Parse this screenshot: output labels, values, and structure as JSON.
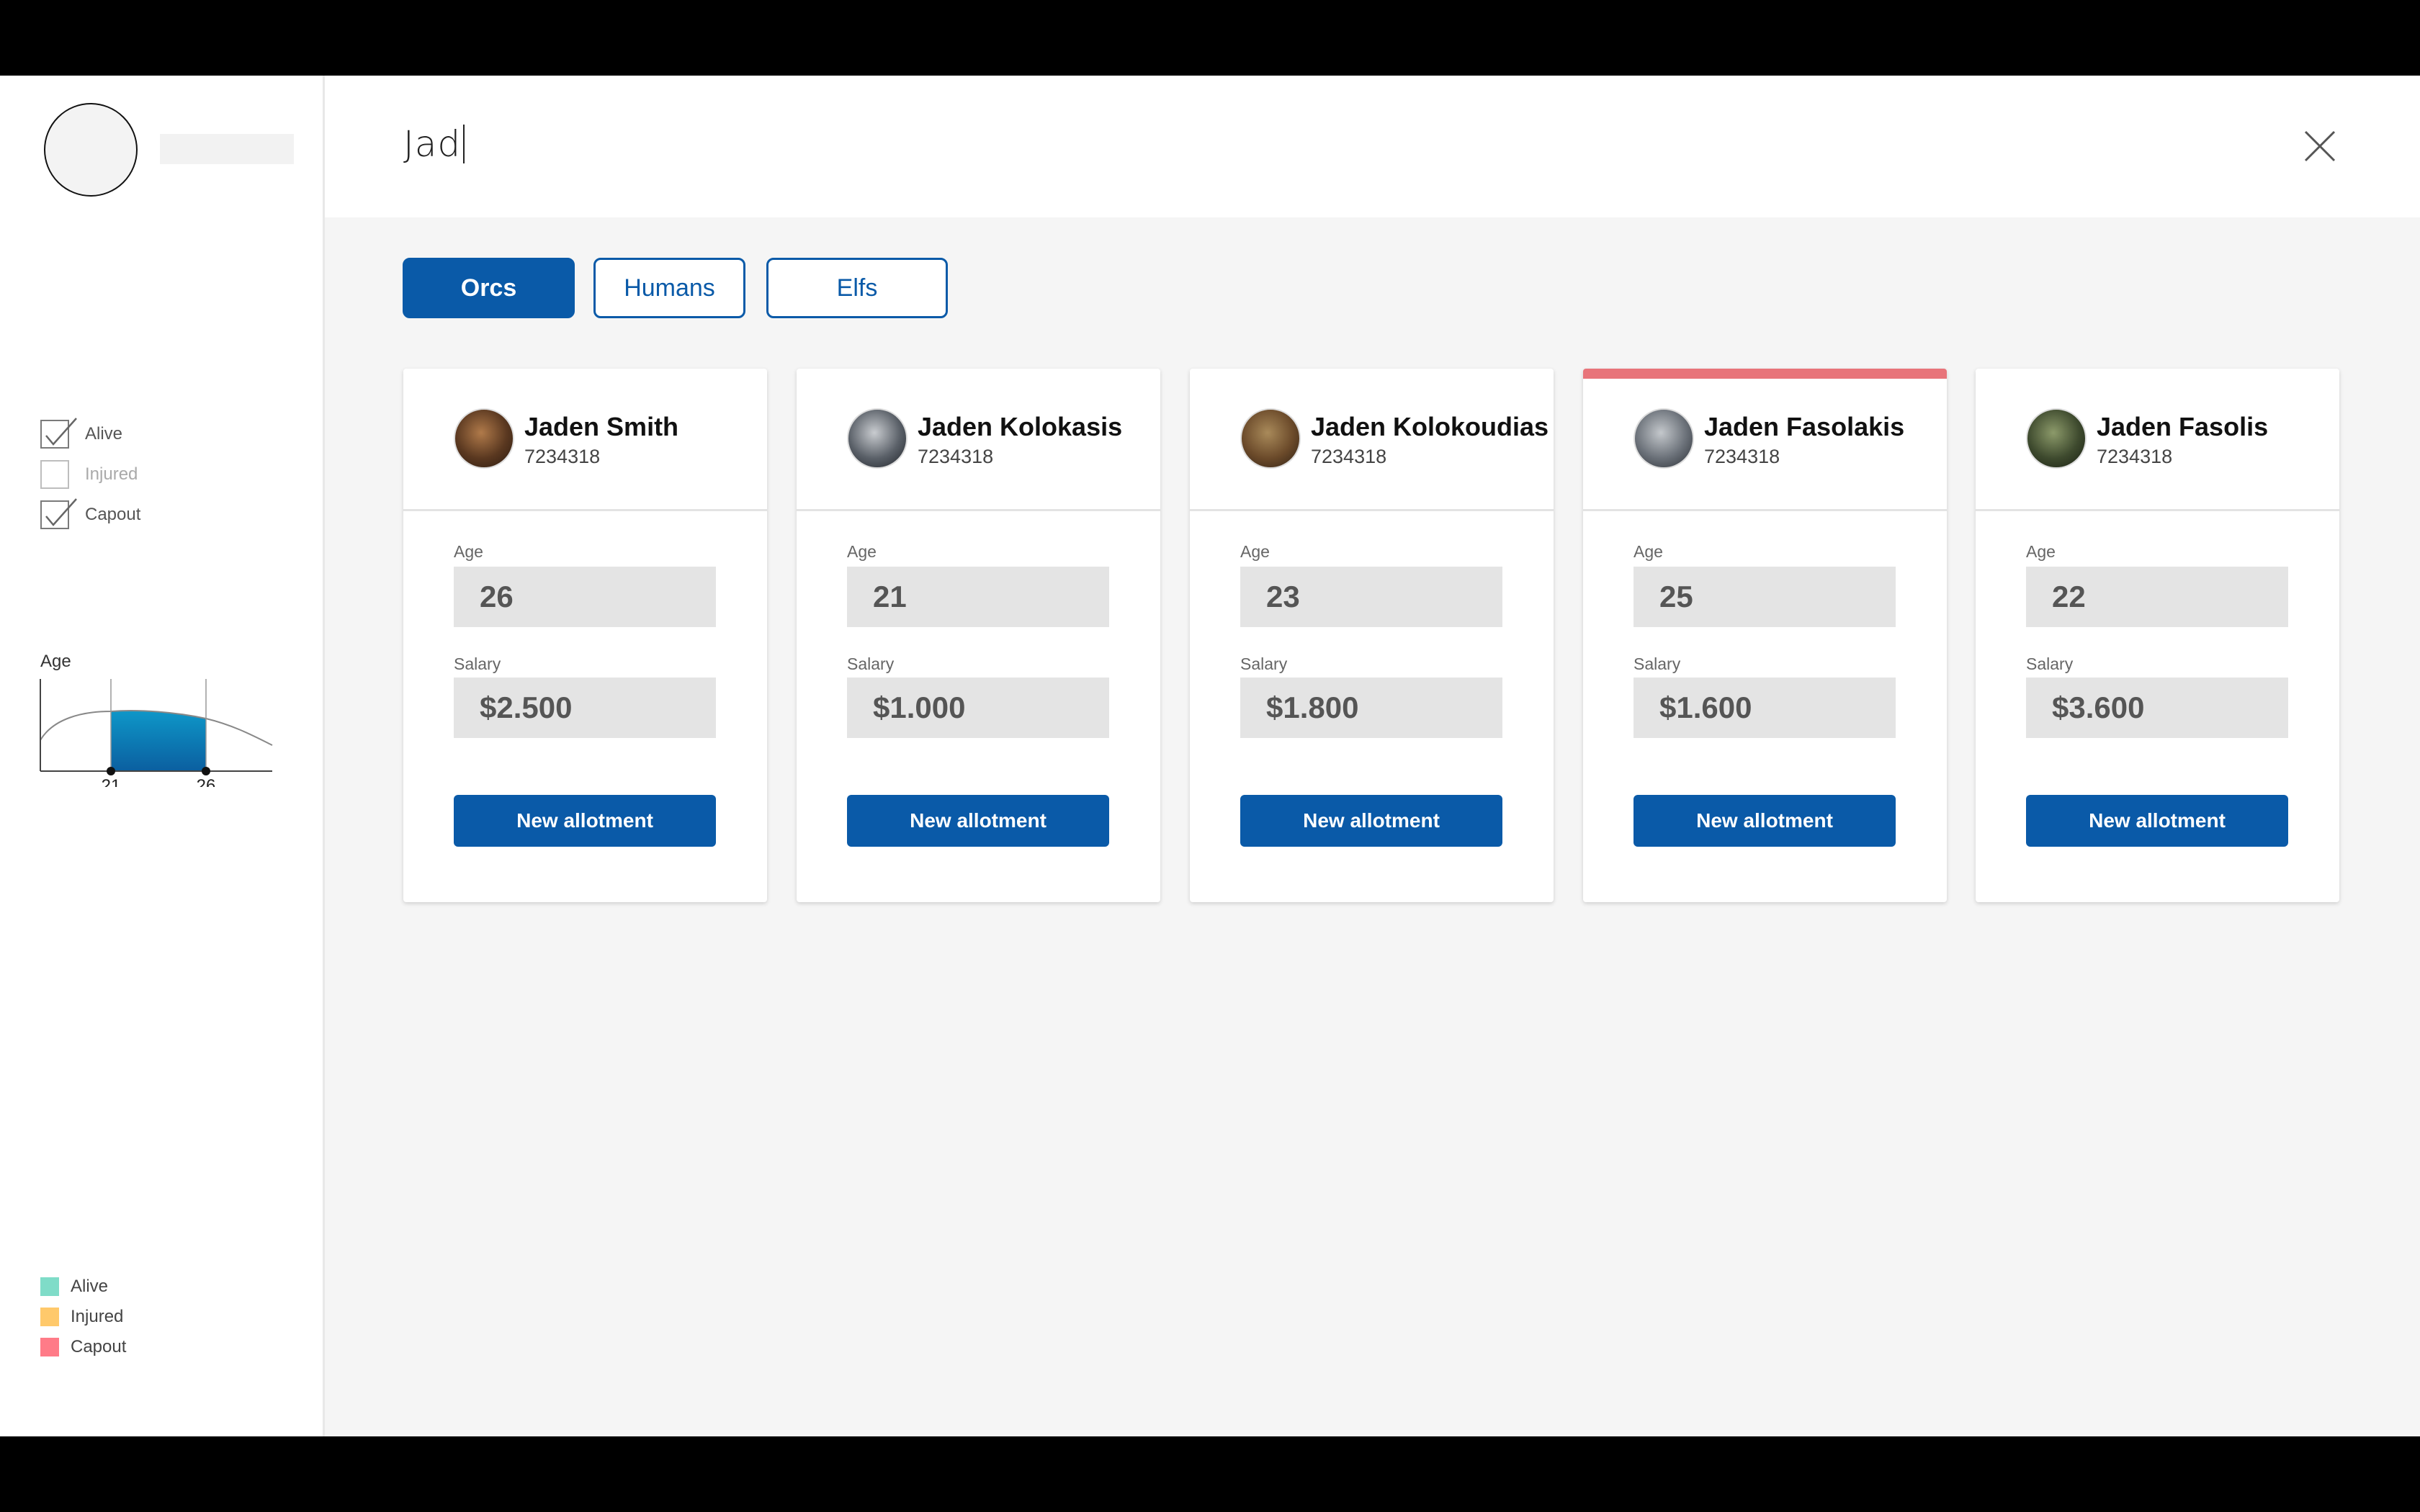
{
  "search": {
    "query": "Jad"
  },
  "sidebar": {
    "filters": [
      {
        "label": "Alive",
        "checked": true
      },
      {
        "label": "Injured",
        "checked": false
      },
      {
        "label": "Capout",
        "checked": true
      }
    ],
    "age_filter": {
      "title": "Age",
      "min": "21",
      "max": "26"
    },
    "legend": [
      {
        "label": "Alive",
        "color": "#7fdcc8"
      },
      {
        "label": "Injured",
        "color": "#ffc96b"
      },
      {
        "label": "Capout",
        "color": "#ff7b88"
      }
    ]
  },
  "tabs": [
    {
      "label": "Orcs",
      "active": true
    },
    {
      "label": "Humans",
      "active": false
    },
    {
      "label": "Elfs",
      "active": false
    }
  ],
  "card_labels": {
    "age": "Age",
    "salary": "Salary",
    "button": "New allotment"
  },
  "cards": [
    {
      "name": "Jaden Smith",
      "id": "7234318",
      "age": "26",
      "salary": "$2.500",
      "status": "normal"
    },
    {
      "name": "Jaden Kolokasis",
      "id": "7234318",
      "age": "21",
      "salary": "$1.000",
      "status": "normal"
    },
    {
      "name": "Jaden Kolokoudias",
      "id": "7234318",
      "age": "23",
      "salary": "$1.800",
      "status": "normal"
    },
    {
      "name": "Jaden Fasolakis",
      "id": "7234318",
      "age": "25",
      "salary": "$1.600",
      "status": "capout"
    },
    {
      "name": "Jaden Fasolis",
      "id": "7234318",
      "age": "22",
      "salary": "$3.600",
      "status": "normal"
    }
  ],
  "colors": {
    "primary": "#0a5aa8",
    "capout_bar": "#e8747a"
  }
}
